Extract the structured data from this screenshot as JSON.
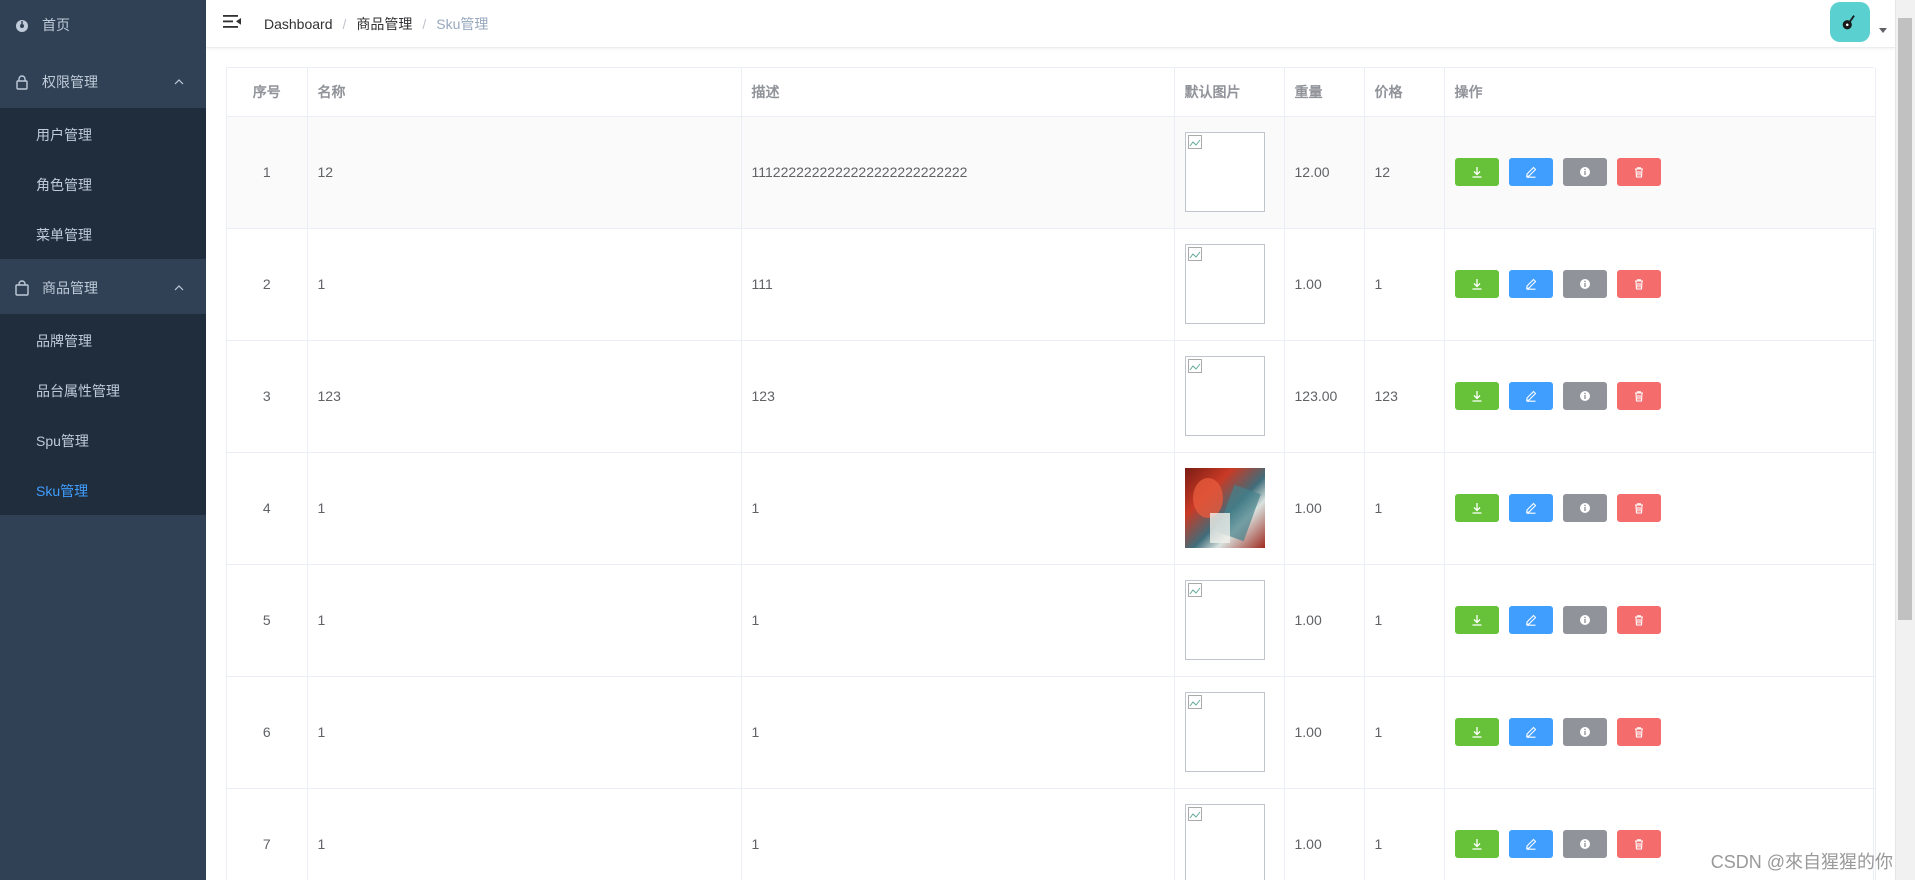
{
  "sidebar": {
    "home": "首页",
    "groups": [
      {
        "label": "权限管理",
        "items": [
          "用户管理",
          "角色管理",
          "菜单管理"
        ]
      },
      {
        "label": "商品管理",
        "items": [
          "品牌管理",
          "品台属性管理",
          "Spu管理",
          "Sku管理"
        ]
      }
    ],
    "active_item": "Sku管理"
  },
  "breadcrumb": [
    "Dashboard",
    "商品管理",
    "Sku管理"
  ],
  "table": {
    "headers": [
      "序号",
      "名称",
      "描述",
      "默认图片",
      "重量",
      "价格",
      "操作"
    ],
    "rows": [
      {
        "index": "1",
        "name": "12",
        "desc": "1112222222222222222222222222",
        "weight": "12.00",
        "price": "12",
        "image": "broken"
      },
      {
        "index": "2",
        "name": "1",
        "desc": "111",
        "weight": "1.00",
        "price": "1",
        "image": "broken"
      },
      {
        "index": "3",
        "name": "123",
        "desc": "123",
        "weight": "123.00",
        "price": "123",
        "image": "broken"
      },
      {
        "index": "4",
        "name": "1",
        "desc": "1",
        "weight": "1.00",
        "price": "1",
        "image": "photo"
      },
      {
        "index": "5",
        "name": "1",
        "desc": "1",
        "weight": "1.00",
        "price": "1",
        "image": "broken"
      },
      {
        "index": "6",
        "name": "1",
        "desc": "1",
        "weight": "1.00",
        "price": "1",
        "image": "broken"
      },
      {
        "index": "7",
        "name": "1",
        "desc": "1",
        "weight": "1.00",
        "price": "1",
        "image": "broken"
      }
    ],
    "actions": [
      "download-icon",
      "edit-icon",
      "info-icon",
      "delete-icon"
    ]
  },
  "colors": {
    "sidebar_bg": "#304156",
    "submenu_bg": "#1f2d3d",
    "active": "#409eff",
    "success": "#67c23a",
    "primary": "#409eff",
    "info": "#909399",
    "danger": "#f56c6c"
  },
  "watermark": "CSDN @來自猩猩的你"
}
